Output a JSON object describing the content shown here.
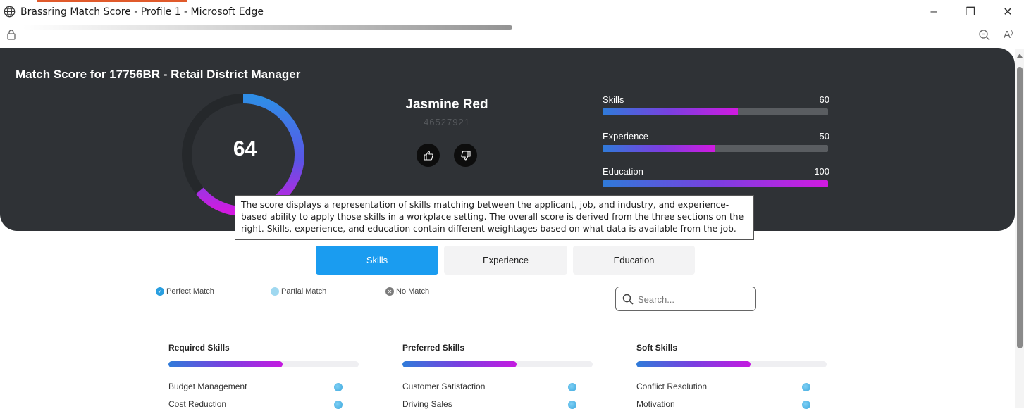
{
  "window": {
    "title": "Brassring Match Score - Profile 1 - Microsoft Edge",
    "minimize": "–",
    "restore": "❐",
    "close": "✕"
  },
  "addressbar": {
    "readaloud": "A⁾"
  },
  "header": {
    "title": "Match Score for 17756BR - Retail District Manager",
    "score": "64",
    "score_fraction": 0.64,
    "candidate_name": "Jasmine Red",
    "candidate_id": "46527921"
  },
  "metrics": [
    {
      "label": "Skills",
      "value": "60",
      "fraction": 0.6
    },
    {
      "label": "Experience",
      "value": "50",
      "fraction": 0.5
    },
    {
      "label": "Education",
      "value": "100",
      "fraction": 1.0
    }
  ],
  "tooltip": {
    "text": "The score displays a representation of skills matching between the applicant, job, and industry, and experience-based ability to apply those skills in a workplace setting. The overall score is derived from the three sections on the right. Skills, experience, and education contain different weightages based on what data is available from the job."
  },
  "tabs": [
    {
      "label": "Skills",
      "active": true
    },
    {
      "label": "Experience",
      "active": false
    },
    {
      "label": "Education",
      "active": false
    }
  ],
  "legend": [
    {
      "label": "Perfect Match",
      "color": "#2a9fe0"
    },
    {
      "label": "Partial Match",
      "color": "#9fd8f0"
    },
    {
      "label": "No Match",
      "color": "#7b7b7b"
    }
  ],
  "search": {
    "placeholder": "Search..."
  },
  "skill_columns": [
    {
      "title": "Required Skills",
      "fraction": 0.6,
      "items": [
        "Budget Management",
        "Cost Reduction"
      ]
    },
    {
      "title": "Preferred Skills",
      "fraction": 0.6,
      "items": [
        "Customer Satisfaction",
        "Driving Sales"
      ]
    },
    {
      "title": "Soft Skills",
      "fraction": 0.6,
      "items": [
        "Conflict Resolution",
        "Motivation"
      ]
    }
  ],
  "colors": {
    "card_bg": "#2f3236",
    "accent_blue": "#1a9cf0",
    "gradient_start": "#2f7bd9",
    "gradient_end": "#d11ae0"
  }
}
